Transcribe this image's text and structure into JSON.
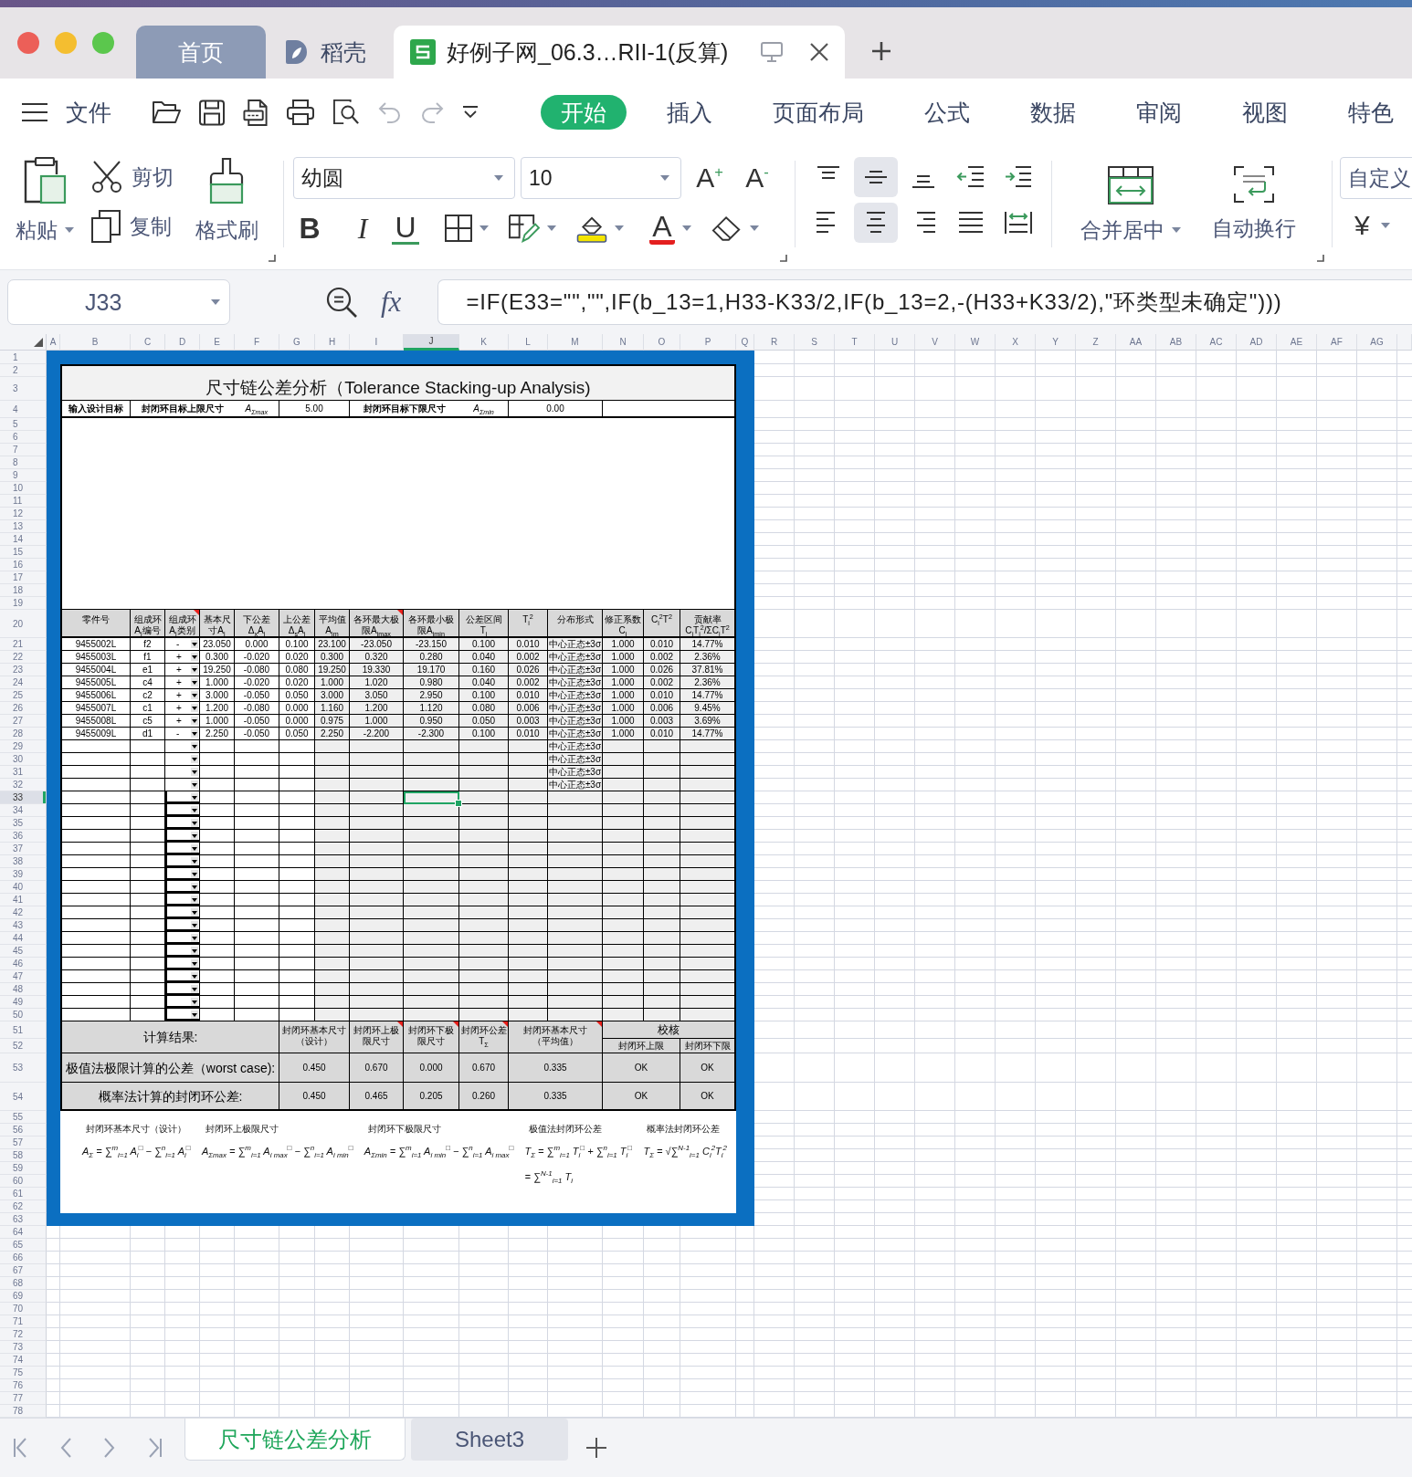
{
  "window": {
    "tabs": [
      {
        "label": "首页",
        "kind": "home",
        "selected": false
      },
      {
        "label": "稻壳",
        "kind": "docer",
        "selected": false
      },
      {
        "label": "好例子网_06.3…RII-1(反算)",
        "kind": "sheet",
        "selected": true
      }
    ]
  },
  "menu": {
    "file": "文件",
    "tabs": [
      {
        "label": "开始",
        "selected": true
      },
      {
        "label": "插入",
        "selected": false
      },
      {
        "label": "页面布局",
        "selected": false
      },
      {
        "label": "公式",
        "selected": false
      },
      {
        "label": "数据",
        "selected": false
      },
      {
        "label": "审阅",
        "selected": false
      },
      {
        "label": "视图",
        "selected": false
      },
      {
        "label": "特色",
        "selected": false
      }
    ]
  },
  "quick_access": [
    {
      "kind": "open",
      "disabled": false
    },
    {
      "kind": "save",
      "disabled": false
    },
    {
      "kind": "pdf",
      "disabled": false
    },
    {
      "kind": "print",
      "disabled": false
    },
    {
      "kind": "preview",
      "disabled": false
    },
    {
      "kind": "undo",
      "disabled": true
    },
    {
      "kind": "redo",
      "disabled": true
    },
    {
      "kind": "customize",
      "disabled": false
    }
  ],
  "ribbon": {
    "clipboard": {
      "paste": "粘贴",
      "cut": "剪切",
      "copy": "复制",
      "painter": "格式刷"
    },
    "font": {
      "name": "幼圆",
      "size": "10",
      "grow": "A$^{+}$",
      "shrink": "A$^{-}$",
      "bold": "B",
      "italic": "I",
      "underline": "U",
      "font_color": "A"
    },
    "alignment": [
      {
        "kind": "top",
        "selected": false
      },
      {
        "kind": "middle",
        "selected": true
      },
      {
        "kind": "bottom",
        "selected": false
      },
      {
        "kind": "outdent",
        "selected": false
      },
      {
        "kind": "indent",
        "selected": false
      },
      {
        "kind": "left",
        "selected": false
      },
      {
        "kind": "center",
        "selected": true
      },
      {
        "kind": "right",
        "selected": false
      },
      {
        "kind": "justify",
        "selected": false
      },
      {
        "kind": "distributed",
        "selected": false
      }
    ],
    "merge": "合并居中",
    "wrap": "自动换行",
    "number_format": "自定义",
    "currency": "¥"
  },
  "formula_bar": {
    "cell": "J33",
    "fx": "fx",
    "formula": "=IF(E33=\"\",\"\",IF(b_13=1,H33-K33/2,IF(b_13=2,-(H33+K33/2),\"环类型未确定\")))"
  },
  "sheet": {
    "columns": [
      {
        "label": "A",
        "selected": false
      },
      {
        "label": "B",
        "selected": false
      },
      {
        "label": "C",
        "selected": false
      },
      {
        "label": "D",
        "selected": false
      },
      {
        "label": "E",
        "selected": false
      },
      {
        "label": "F",
        "selected": false
      },
      {
        "label": "G",
        "selected": false
      },
      {
        "label": "H",
        "selected": false
      },
      {
        "label": "I",
        "selected": false
      },
      {
        "label": "J",
        "selected": true
      },
      {
        "label": "K",
        "selected": false
      },
      {
        "label": "L",
        "selected": false
      },
      {
        "label": "M",
        "selected": false
      },
      {
        "label": "N",
        "selected": false
      },
      {
        "label": "O",
        "selected": false
      },
      {
        "label": "P",
        "selected": false
      },
      {
        "label": "Q",
        "selected": false
      },
      {
        "label": "R",
        "selected": false
      },
      {
        "label": "S",
        "selected": false
      },
      {
        "label": "T",
        "selected": false
      },
      {
        "label": "U",
        "selected": false
      },
      {
        "label": "V",
        "selected": false
      },
      {
        "label": "W",
        "selected": false
      },
      {
        "label": "X",
        "selected": false
      },
      {
        "label": "Y",
        "selected": false
      },
      {
        "label": "Z",
        "selected": false
      },
      {
        "label": "AA",
        "selected": false
      },
      {
        "label": "AB",
        "selected": false
      },
      {
        "label": "AC",
        "selected": false
      },
      {
        "label": "AD",
        "selected": false
      },
      {
        "label": "AE",
        "selected": false
      },
      {
        "label": "AF",
        "selected": false
      },
      {
        "label": "AG",
        "selected": false
      }
    ],
    "rows": [
      {
        "label": "1",
        "selected": false
      },
      {
        "label": "2",
        "selected": false
      },
      {
        "label": "3",
        "selected": false
      },
      {
        "label": "4",
        "selected": false
      },
      {
        "label": "5",
        "selected": false
      },
      {
        "label": "6",
        "selected": false
      },
      {
        "label": "7",
        "selected": false
      },
      {
        "label": "8",
        "selected": false
      },
      {
        "label": "9",
        "selected": false
      },
      {
        "label": "10",
        "selected": false
      },
      {
        "label": "11",
        "selected": false
      },
      {
        "label": "12",
        "selected": false
      },
      {
        "label": "13",
        "selected": false
      },
      {
        "label": "14",
        "selected": false
      },
      {
        "label": "15",
        "selected": false
      },
      {
        "label": "16",
        "selected": false
      },
      {
        "label": "17",
        "selected": false
      },
      {
        "label": "18",
        "selected": false
      },
      {
        "label": "19",
        "selected": false
      },
      {
        "label": "20",
        "selected": false
      },
      {
        "label": "21",
        "selected": false
      },
      {
        "label": "22",
        "selected": false
      },
      {
        "label": "23",
        "selected": false
      },
      {
        "label": "24",
        "selected": false
      },
      {
        "label": "25",
        "selected": false
      },
      {
        "label": "26",
        "selected": false
      },
      {
        "label": "27",
        "selected": false
      },
      {
        "label": "28",
        "selected": false
      },
      {
        "label": "29",
        "selected": false
      },
      {
        "label": "30",
        "selected": false
      },
      {
        "label": "31",
        "selected": false
      },
      {
        "label": "32",
        "selected": false
      },
      {
        "label": "33",
        "selected": true
      },
      {
        "label": "34",
        "selected": false
      },
      {
        "label": "35",
        "selected": false
      },
      {
        "label": "36",
        "selected": false
      },
      {
        "label": "37",
        "selected": false
      },
      {
        "label": "38",
        "selected": false
      },
      {
        "label": "39",
        "selected": false
      },
      {
        "label": "40",
        "selected": false
      },
      {
        "label": "41",
        "selected": false
      },
      {
        "label": "42",
        "selected": false
      },
      {
        "label": "43",
        "selected": false
      },
      {
        "label": "44",
        "selected": false
      },
      {
        "label": "45",
        "selected": false
      },
      {
        "label": "46",
        "selected": false
      },
      {
        "label": "47",
        "selected": false
      },
      {
        "label": "48",
        "selected": false
      },
      {
        "label": "49",
        "selected": false
      },
      {
        "label": "50",
        "selected": false
      },
      {
        "label": "51",
        "selected": false
      },
      {
        "label": "52",
        "selected": false
      },
      {
        "label": "53",
        "selected": false
      },
      {
        "label": "54",
        "selected": false
      },
      {
        "label": "55",
        "selected": false
      },
      {
        "label": "56",
        "selected": false
      },
      {
        "label": "57",
        "selected": false
      },
      {
        "label": "58",
        "selected": false
      },
      {
        "label": "59",
        "selected": false
      },
      {
        "label": "60",
        "selected": false
      },
      {
        "label": "61",
        "selected": false
      },
      {
        "label": "62",
        "selected": false
      },
      {
        "label": "63",
        "selected": false
      },
      {
        "label": "64",
        "selected": false
      },
      {
        "label": "65",
        "selected": false
      },
      {
        "label": "66",
        "selected": false
      },
      {
        "label": "67",
        "selected": false
      },
      {
        "label": "68",
        "selected": false
      },
      {
        "label": "69",
        "selected": false
      },
      {
        "label": "70",
        "selected": false
      },
      {
        "label": "71",
        "selected": false
      },
      {
        "label": "72",
        "selected": false
      },
      {
        "label": "73",
        "selected": false
      },
      {
        "label": "74",
        "selected": false
      },
      {
        "label": "75",
        "selected": false
      },
      {
        "label": "76",
        "selected": false
      },
      {
        "label": "77",
        "selected": false
      },
      {
        "label": "78",
        "selected": false
      }
    ]
  },
  "table": {
    "title": "尺寸链公差分析（Tolerance Stacking-up Analysis)",
    "target": {
      "label": "输入设计目标",
      "upper_label": "封闭环目标上限尺寸",
      "upper_symbol": "A$_{Σmax}$",
      "upper_value": "5.00",
      "lower_label": "封闭环目标下限尺寸",
      "lower_symbol": "A$_{Σmin}$",
      "lower_value": "0.00"
    },
    "headers": [
      {
        "text": "零件号",
        "comment": false
      },
      {
        "text": "组成环A$_{i}$编号",
        "comment": false
      },
      {
        "text": "组成环A$_{i}$类别",
        "comment": true
      },
      {
        "text": "基本尺寸A$_{i}$",
        "comment": false
      },
      {
        "text": "下公差Δ$_{x}$A$_{i}$",
        "comment": false
      },
      {
        "text": "上公差Δ$_{s}$A$_{i}$",
        "comment": false
      },
      {
        "text": "平均值A$_{im}$",
        "comment": false
      },
      {
        "text": "各环最大极限A$_{imax}$",
        "comment": true
      },
      {
        "text": "各环最小极限A$_{imin}$",
        "comment": false
      },
      {
        "text": "公差区间T$_{i}$",
        "comment": false
      },
      {
        "text": "T$_{i}$$^{2}$",
        "comment": false
      },
      {
        "text": "分布形式",
        "comment": false
      },
      {
        "text": "修正系数C$_{i}$",
        "comment": false
      },
      {
        "text": "C$_{i}$$^{2}$T$^{2}$",
        "comment": false
      },
      {
        "text": "贡献率C$_{i}$T$_{i}$$^{2}$/ΣC$_{i}$T$^{2}$",
        "comment": false
      }
    ],
    "rows": [
      {
        "part_no": "9455002L",
        "ring_id": "f2",
        "ring_type": "-",
        "basic": "23.050",
        "lower_dev": "0.000",
        "upper_dev": "0.100",
        "mean": "23.100",
        "max_limit": "-23.050",
        "min_limit": "-23.150",
        "tolerance": "0.100",
        "t_squared": "0.010",
        "distribution": "中心正态±3σ",
        "coefficient": "1.000",
        "c2t2": "0.010",
        "contribution": "14.77%"
      },
      {
        "part_no": "9455003L",
        "ring_id": "f1",
        "ring_type": "+",
        "basic": "0.300",
        "lower_dev": "-0.020",
        "upper_dev": "0.020",
        "mean": "0.300",
        "max_limit": "0.320",
        "min_limit": "0.280",
        "tolerance": "0.040",
        "t_squared": "0.002",
        "distribution": "中心正态±3σ",
        "coefficient": "1.000",
        "c2t2": "0.002",
        "contribution": "2.36%"
      },
      {
        "part_no": "9455004L",
        "ring_id": "e1",
        "ring_type": "+",
        "basic": "19.250",
        "lower_dev": "-0.080",
        "upper_dev": "0.080",
        "mean": "19.250",
        "max_limit": "19.330",
        "min_limit": "19.170",
        "tolerance": "0.160",
        "t_squared": "0.026",
        "distribution": "中心正态±3σ",
        "coefficient": "1.000",
        "c2t2": "0.026",
        "contribution": "37.81%"
      },
      {
        "part_no": "9455005L",
        "ring_id": "c4",
        "ring_type": "+",
        "basic": "1.000",
        "lower_dev": "-0.020",
        "upper_dev": "0.020",
        "mean": "1.000",
        "max_limit": "1.020",
        "min_limit": "0.980",
        "tolerance": "0.040",
        "t_squared": "0.002",
        "distribution": "中心正态±3σ",
        "coefficient": "1.000",
        "c2t2": "0.002",
        "contribution": "2.36%"
      },
      {
        "part_no": "9455006L",
        "ring_id": "c2",
        "ring_type": "+",
        "basic": "3.000",
        "lower_dev": "-0.050",
        "upper_dev": "0.050",
        "mean": "3.000",
        "max_limit": "3.050",
        "min_limit": "2.950",
        "tolerance": "0.100",
        "t_squared": "0.010",
        "distribution": "中心正态±3σ",
        "coefficient": "1.000",
        "c2t2": "0.010",
        "contribution": "14.77%"
      },
      {
        "part_no": "9455007L",
        "ring_id": "c1",
        "ring_type": "+",
        "basic": "1.200",
        "lower_dev": "-0.080",
        "upper_dev": "0.000",
        "mean": "1.160",
        "max_limit": "1.200",
        "min_limit": "1.120",
        "tolerance": "0.080",
        "t_squared": "0.006",
        "distribution": "中心正态±3σ",
        "coefficient": "1.000",
        "c2t2": "0.006",
        "contribution": "9.45%"
      },
      {
        "part_no": "9455008L",
        "ring_id": "c5",
        "ring_type": "+",
        "basic": "1.000",
        "lower_dev": "-0.050",
        "upper_dev": "0.000",
        "mean": "0.975",
        "max_limit": "1.000",
        "min_limit": "0.950",
        "tolerance": "0.050",
        "t_squared": "0.003",
        "distribution": "中心正态±3σ",
        "coefficient": "1.000",
        "c2t2": "0.003",
        "contribution": "3.69%"
      },
      {
        "part_no": "9455009L",
        "ring_id": "d1",
        "ring_type": "-",
        "basic": "2.250",
        "lower_dev": "-0.050",
        "upper_dev": "0.050",
        "mean": "2.250",
        "max_limit": "-2.200",
        "min_limit": "-2.300",
        "tolerance": "0.100",
        "t_squared": "0.010",
        "distribution": "中心正态±3σ",
        "coefficient": "1.000",
        "c2t2": "0.010",
        "contribution": "14.77%"
      },
      {
        "distribution": "中心正态±3σ"
      },
      {
        "distribution": "中心正态±3σ"
      },
      {
        "distribution": "中心正态±3σ"
      },
      {
        "distribution": "中心正态±3σ"
      }
    ]
  },
  "results": {
    "title": "计算结果:",
    "headers": [
      {
        "text": "封闭环基本尺寸（设计）",
        "comment": false
      },
      {
        "text": "封闭环上极限尺寸",
        "comment": true
      },
      {
        "text": "封闭环下极限尺寸",
        "comment": true
      },
      {
        "text": "封闭环公差T$_{Σ}$",
        "comment": true
      },
      {
        "text": "封闭环基本尺寸（平均值）",
        "comment": true
      }
    ],
    "check_title": "校核",
    "check_columns": [
      "封闭环上限",
      "封闭环下限"
    ],
    "rows": [
      {
        "label": "极值法极限计算的公差（worst case):",
        "values": [
          "0.450",
          "0.670",
          "0.000",
          "0.670",
          "0.335"
        ],
        "checks": [
          "OK",
          "OK"
        ]
      },
      {
        "label": "概率法计算的封闭环公差:",
        "values": [
          "0.450",
          "0.465",
          "0.205",
          "0.260",
          "0.335"
        ],
        "checks": [
          "OK",
          "OK"
        ]
      }
    ]
  },
  "formulas": [
    {
      "caption": "封闭环基本尺寸（设计）",
      "lines": [
        "A$_{Σ}$ = ∑$^{m}$$_{i=1}$ A$_{i}$$^{□}$ − ∑$^{n}$$_{i=1}$ A$_{i}$$^{□}$"
      ]
    },
    {
      "caption": "封闭环上极限尺寸",
      "lines": [
        "A$_{Σmax}$ = ∑$^{m}$$_{i=1}$ A$_{i max}$$^{□}$ − ∑$^{n}$$_{i=1}$ A$_{i min}$$^{□}$"
      ]
    },
    {
      "caption": "封闭环下极限尺寸",
      "lines": [
        "A$_{Σmin}$ = ∑$^{m}$$_{i=1}$ A$_{i min}$$^{□}$ − ∑$^{n}$$_{i=1}$ A$_{i max}$$^{□}$"
      ]
    },
    {
      "caption": "极值法封闭环公差",
      "lines": [
        "T$_{Σ}$ = ∑$^{m}$$_{i=1}$ T$_{i}$$^{□}$ + ∑$^{n}$$_{i=1}$ T$_{i}$$^{□}$",
        "= ∑$^{N-1}$$_{i=1}$ T$_{i}$"
      ]
    },
    {
      "caption": "概率法封闭环公差",
      "lines": [
        "T$_{Σ}$ = √∑$^{N-1}$$_{i=1}$ C$_{i}$$^{2}$T$_{i}$$^{2}$"
      ]
    }
  ],
  "sheet_tabs": [
    {
      "label": "尺寸链公差分析",
      "selected": true
    },
    {
      "label": "Sheet3",
      "selected": false
    }
  ]
}
